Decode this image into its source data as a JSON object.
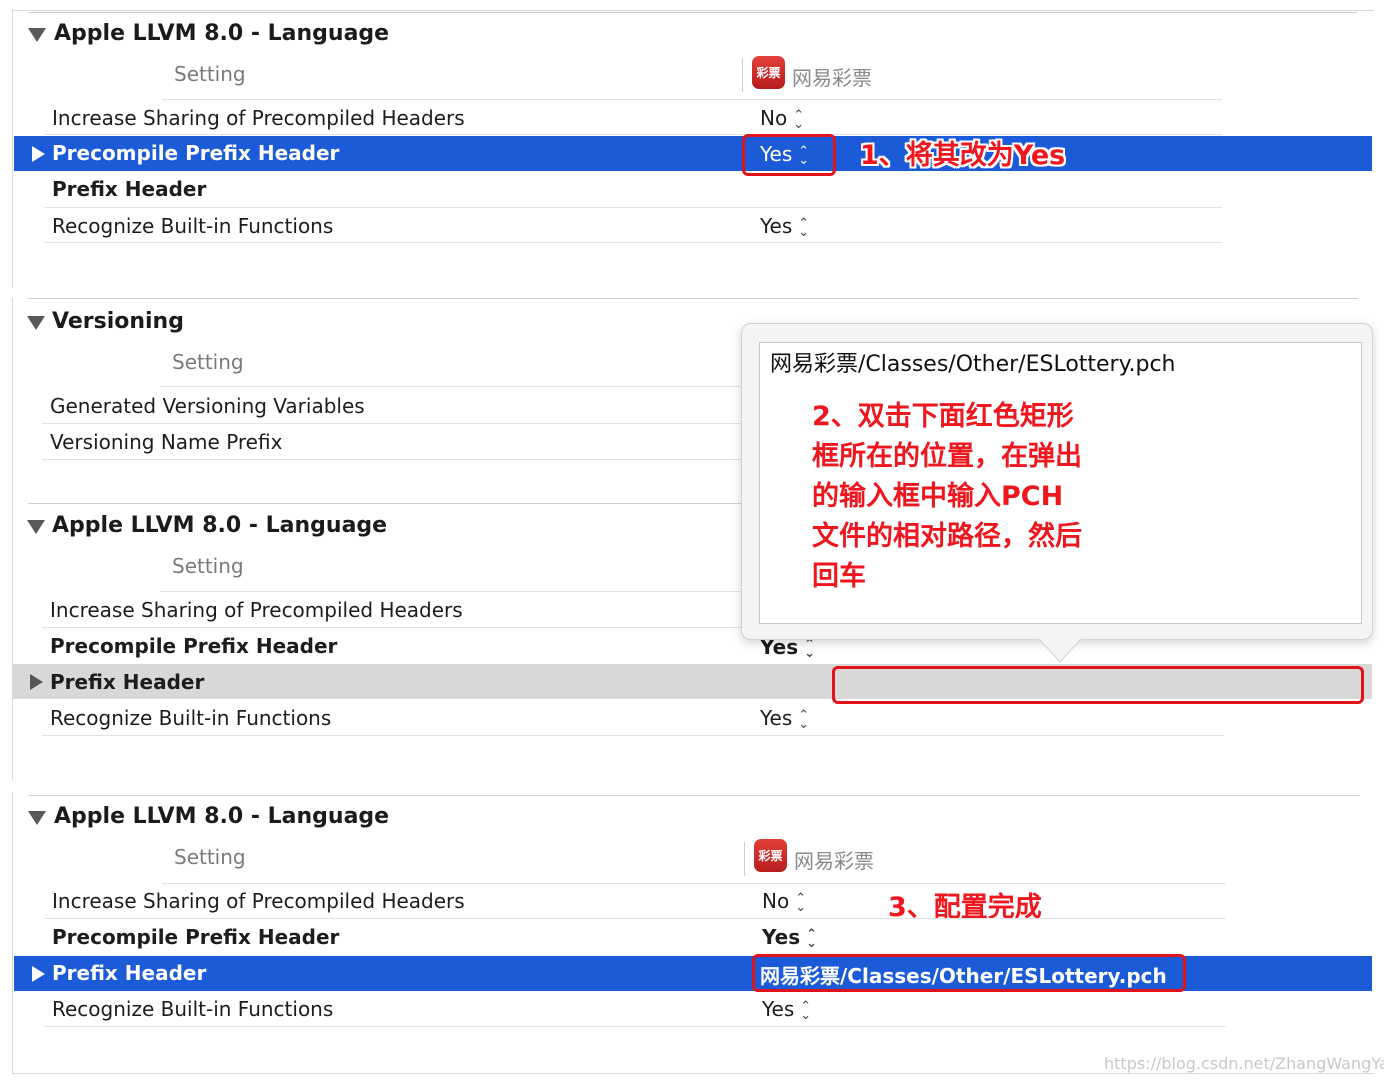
{
  "colors": {
    "selection": "#1c5bd8",
    "annotation_red": "#e0131b",
    "gray_selection": "#d8d8d8"
  },
  "target": {
    "name": "网易彩票",
    "icon_text": "彩票"
  },
  "panel1": {
    "title": "Apple LLVM 8.0 - Language",
    "setting_header": "Setting",
    "rows": [
      {
        "label": "Increase Sharing of Precompiled Headers",
        "value": "No"
      },
      {
        "label": "Precompile Prefix Header",
        "value": "Yes"
      },
      {
        "label": "Prefix Header",
        "value": ""
      },
      {
        "label": "Recognize Built-in Functions",
        "value": "Yes"
      }
    ],
    "annotation": "1、将其改为Yes"
  },
  "panel2": {
    "versioning": {
      "title": "Versioning",
      "setting_header": "Setting",
      "rows": [
        {
          "label": "Generated Versioning Variables"
        },
        {
          "label": "Versioning Name Prefix"
        }
      ]
    },
    "language": {
      "title": "Apple LLVM 8.0 - Language",
      "setting_header": "Setting",
      "rows": [
        {
          "label": "Increase Sharing of Precompiled Headers",
          "value": ""
        },
        {
          "label": "Precompile Prefix Header",
          "value": "Yes"
        },
        {
          "label": "Prefix Header",
          "value": ""
        },
        {
          "label": "Recognize Built-in Functions",
          "value": "Yes"
        }
      ]
    },
    "popover": {
      "input_value": "网易彩票/Classes/Other/ESLottery.pch",
      "annotation_lines": [
        "2、双击下面红色矩形",
        "框所在的位置，在弹出",
        "的输入框中输入PCH",
        "文件的相对路径，然后",
        "回车"
      ]
    }
  },
  "panel3": {
    "title": "Apple LLVM 8.0 - Language",
    "setting_header": "Setting",
    "rows": [
      {
        "label": "Increase Sharing of Precompiled Headers",
        "value": "No"
      },
      {
        "label": "Precompile Prefix Header",
        "value": "Yes"
      },
      {
        "label": "Prefix Header",
        "value": "网易彩票/Classes/Other/ESLottery.pch"
      },
      {
        "label": "Recognize Built-in Functions",
        "value": "Yes"
      }
    ],
    "annotation": "3、配置完成"
  },
  "watermark": "https://blog.csdn.net/ZhangWangYang"
}
